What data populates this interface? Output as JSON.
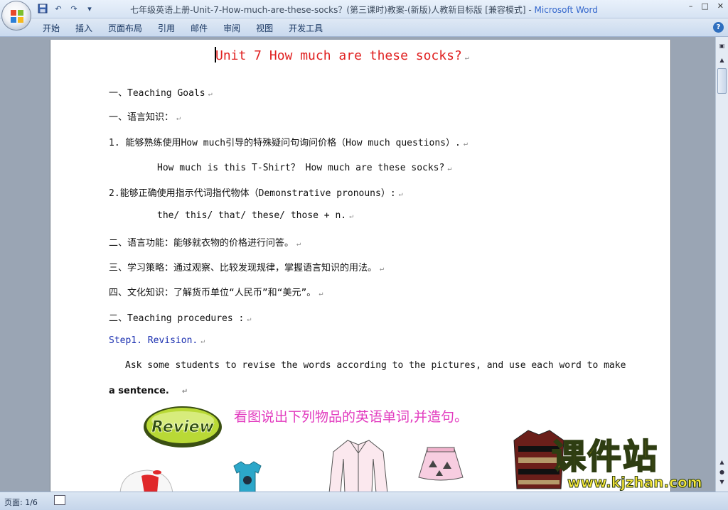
{
  "window": {
    "title_doc": "七年级英语上册-Unit-7-How-much-are-these-socks？(第三课时)教案-(新版)人教新目标版 [兼容模式] - ",
    "title_app": "Microsoft Word",
    "controls": [
      "–",
      "□",
      "✕"
    ]
  },
  "ribbon": {
    "tabs": [
      "开始",
      "插入",
      "页面布局",
      "引用",
      "邮件",
      "审阅",
      "视图",
      "开发工具"
    ],
    "help": "?"
  },
  "document": {
    "title": "Unit 7   How much are these socks?",
    "lines": [
      "一、Teaching Goals",
      "一、语言知识：",
      "1. 能够熟练使用How much引导的特殊疑问句询问价格（How much questions）.",
      "How much is this T-Shirt？   How much are these socks?",
      "2.能够正确使用指示代词指代物体（Demonstrative pronouns）:",
      "the/ this/ that/ these/ those + n.",
      "二、语言功能：能够就衣物的价格进行问答。",
      "三、学习策略：通过观察、比较发现规律，掌握语言知识的用法。",
      "四、文化知识：了解货币单位“人民币”和“美元”。",
      "二、Teaching procedures :"
    ],
    "step": "Step1. Revision.",
    "para1": "Ask some students to revise the words according to the pictures, and use each word to make",
    "para2": "a sentence.",
    "review_label": "Review",
    "picture_caption": "看图说出下列物品的英语单词,并造句。",
    "para_mark": "↵"
  },
  "statusbar": {
    "page_info": "页面: 1/6"
  },
  "watermark": {
    "text": "课件站",
    "url": "www.kjzhan.com"
  },
  "colors": {
    "title_red": "#e02020",
    "step_blue": "#1a2fb0",
    "caption_pink": "#e23bbf"
  }
}
